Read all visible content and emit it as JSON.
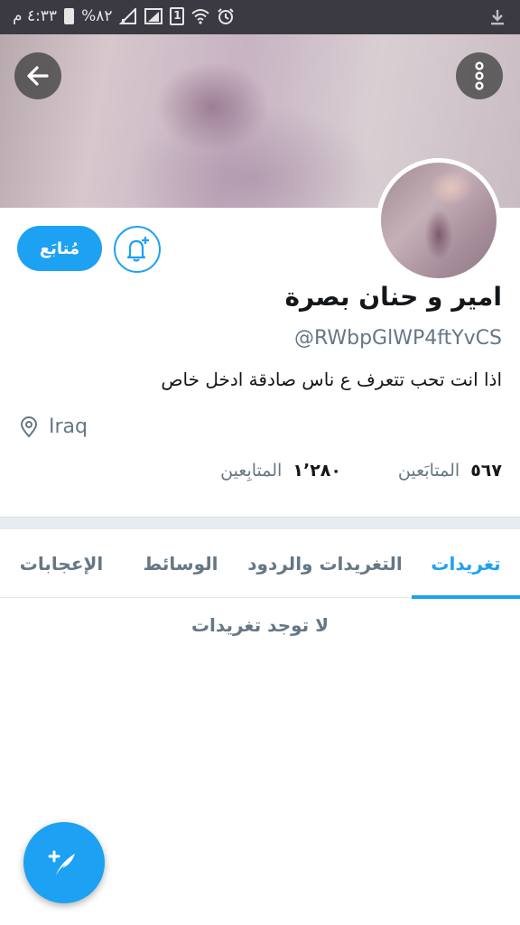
{
  "status_bar": {
    "time": "٤:٣٣ م",
    "battery": "%٨٢",
    "sim_label": "1",
    "icons": [
      "battery-icon",
      "signal-icon",
      "signal-icon",
      "sim-icon",
      "wifi-icon",
      "alarm-icon",
      "download-icon"
    ]
  },
  "profile": {
    "name": "امير و حنان بصرة",
    "handle": "@RWbpGlWP4ftYvCS",
    "bio": "اذا انت تحب تتعرف ع ناس صادقة ادخل خاص",
    "location": "Iraq",
    "following_count": "٥٦٧",
    "following_label": "المتابَعين",
    "followers_count": "١٬٢٨٠",
    "followers_label": "المتابِعين"
  },
  "actions": {
    "follow_label": "مُتابَع"
  },
  "tabs": [
    {
      "label": "تغريدات",
      "active": true
    },
    {
      "label": "التغريدات والردود",
      "active": false
    },
    {
      "label": "الوسائط",
      "active": false
    },
    {
      "label": "الإعجابات",
      "active": false
    }
  ],
  "empty_state": "لا توجد تغريدات",
  "colors": {
    "accent": "#1da1f2",
    "status_bar": "#3b3a43",
    "secondary_text": "#657786"
  }
}
